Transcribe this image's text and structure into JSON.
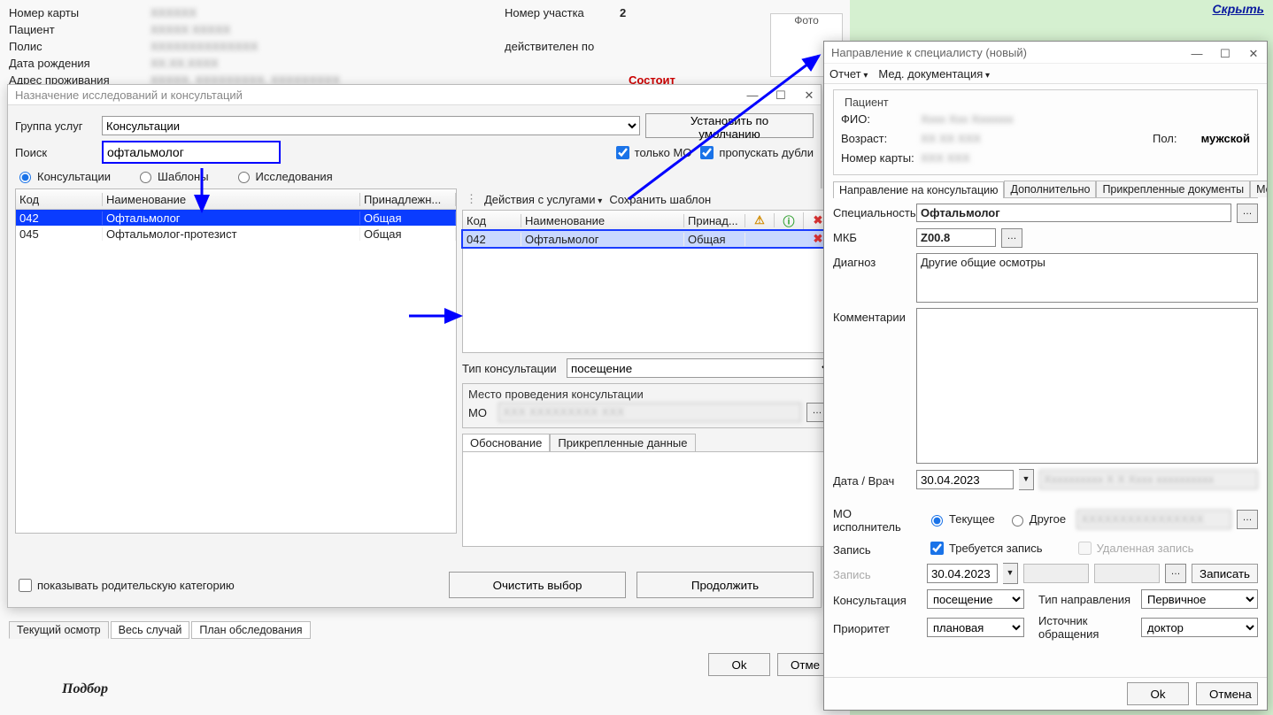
{
  "top_link": "Скрыть",
  "patient_info": {
    "card_no_label": "Номер карты",
    "patient_label": "Пациент",
    "policy_label": "Полис",
    "dob_label": "Дата рождения",
    "addr_label": "Адрес проживания",
    "sector_label": "Номер участка",
    "sector_value": "2",
    "valid_label": "действителен по",
    "photo_label": "Фото",
    "status_label": "Состоит"
  },
  "dlg1": {
    "title": "Назначение исследований и консультаций",
    "group_label": "Группа услуг",
    "group_value": "Консультации",
    "default_btn": "Установить по умолчанию",
    "search_label": "Поиск",
    "search_value": "офтальмолог",
    "only_mo": "только МО",
    "skip_dups": "пропускать дубли",
    "radios": {
      "consult": "Консультации",
      "templates": "Шаблоны",
      "research": "Исследования"
    },
    "left_cols": {
      "code": "Код",
      "name": "Наименование",
      "belong": "Принадлежн..."
    },
    "left_rows": [
      {
        "code": "042",
        "name": "Офтальмолог",
        "belong": "Общая"
      },
      {
        "code": "045",
        "name": "Офтальмолог-протезист",
        "belong": "Общая"
      }
    ],
    "right_toolbar": {
      "actions": "Действия с услугами",
      "save_tmpl": "Сохранить шаблон"
    },
    "right_cols": {
      "code": "Код",
      "name": "Наименование",
      "belong": "Принад..."
    },
    "right_rows": [
      {
        "code": "042",
        "name": "Офтальмолог",
        "belong": "Общая"
      }
    ],
    "cons_type_label": "Тип консультации",
    "cons_type_value": "посещение",
    "place_legend": "Место проведения консультации",
    "mo_label": "МО",
    "tabs": {
      "basis": "Обоснование",
      "attach": "Прикрепленные данные"
    },
    "show_parent": "показывать родительскую категорию",
    "clear_btn": "Очистить выбор",
    "continue_btn": "Продолжить"
  },
  "main_tabs": {
    "current": "Текущий осмотр",
    "whole": "Весь случай",
    "plan": "План обследования"
  },
  "ok_btn": "Ok",
  "cancel_btn": "Отме",
  "podbor": "Подбор",
  "dlg2": {
    "title": "Направление к специалисту (новый)",
    "menu": {
      "report": "Отчет",
      "meddoc": "Мед. документация"
    },
    "patient_grp": "Пациент",
    "fio": "ФИО:",
    "age": "Возраст:",
    "sex_label": "Пол:",
    "sex_value": "мужской",
    "card": "Номер карты:",
    "tabs": [
      "Направление на консультацию",
      "Дополнительно",
      "Прикрепленные документы",
      "Мед до"
    ],
    "spec_label": "Специальность",
    "spec_value": "Офтальмолог",
    "mkb_label": "МКБ",
    "mkb_value": "Z00.8",
    "diag_label": "Диагноз",
    "diag_value": "Другие общие осмотры",
    "comment_label": "Комментарии",
    "date_doc_label": "Дата / Врач",
    "date_doc_value": "30.04.2023",
    "mo_exec_label": "МО исполнитель",
    "mo_current": "Текущее",
    "mo_other": "Другое",
    "record_label": "Запись",
    "need_record": "Требуется запись",
    "remote_record": "Удаленная запись",
    "record2_label": "Запись",
    "record2_date": "30.04.2023",
    "record_btn": "Записать",
    "consult_label": "Консультация",
    "consult_value": "посещение",
    "ref_type_label": "Тип направления",
    "ref_type_value": "Первичное",
    "priority_label": "Приоритет",
    "priority_value": "плановая",
    "source_label": "Источник обращения",
    "source_value": "доктор",
    "ok": "Ok",
    "cancel": "Отмена"
  }
}
